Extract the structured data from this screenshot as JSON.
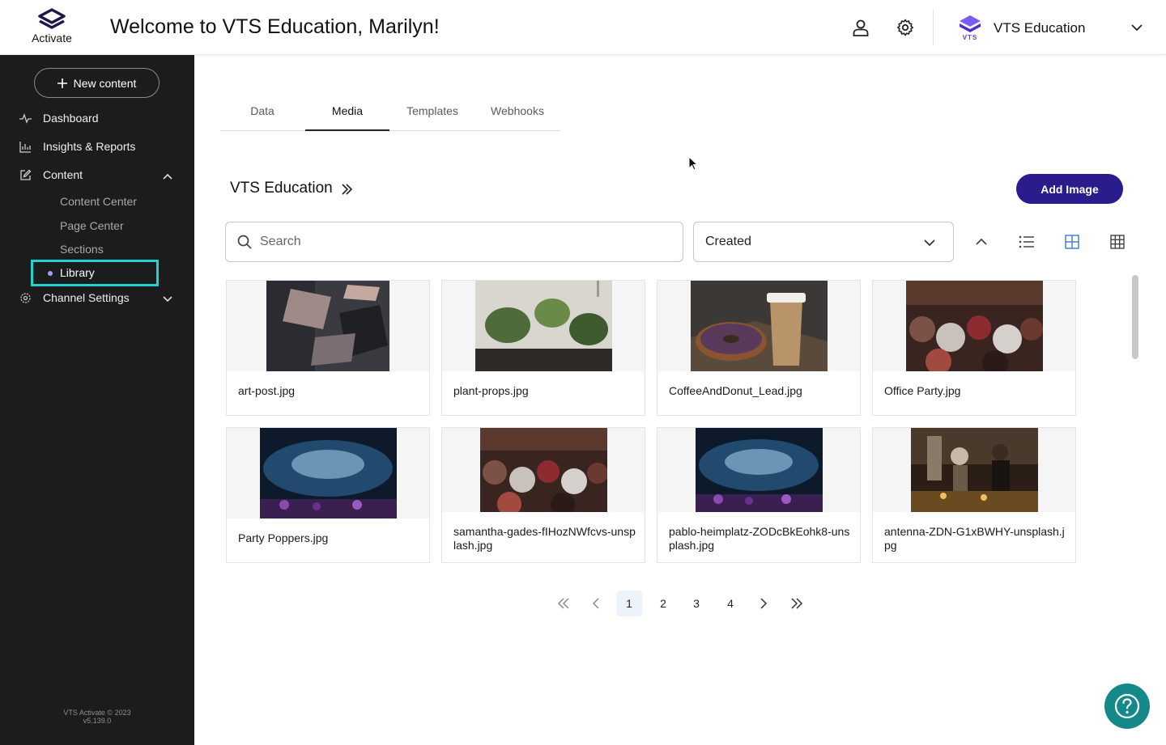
{
  "brand": {
    "name": "Activate"
  },
  "header": {
    "welcome": "Welcome to VTS Education, Marilyn!",
    "org_name": "VTS Education",
    "org_logo_text": "VTS"
  },
  "sidebar": {
    "new_content_label": "New content",
    "items": [
      {
        "label": "Dashboard",
        "icon": "pulse-icon"
      },
      {
        "label": "Insights & Reports",
        "icon": "bar-chart-icon"
      },
      {
        "label": "Content",
        "icon": "edit-icon",
        "expanded": true
      },
      {
        "label": "Channel Settings",
        "icon": "gear-icon",
        "expanded": false
      }
    ],
    "content_subitems": [
      "Content Center",
      "Page Center",
      "Sections",
      "Library"
    ],
    "active_subitem": "Library",
    "footer_line1": "VTS Activate © 2023",
    "footer_line2": "v5.139.0"
  },
  "tabs": [
    {
      "label": "Data"
    },
    {
      "label": "Media"
    },
    {
      "label": "Templates"
    },
    {
      "label": "Webhooks"
    }
  ],
  "active_tab": "Media",
  "library": {
    "folder_title": "VTS Education",
    "add_image_label": "Add Image",
    "search_placeholder": "Search",
    "sort_value": "Created"
  },
  "files": [
    {
      "name": "art-post.jpg"
    },
    {
      "name": "plant-props.jpg"
    },
    {
      "name": "CoffeeAndDonut_Lead.jpg"
    },
    {
      "name": "Office Party.jpg"
    },
    {
      "name": "Party Poppers.jpg"
    },
    {
      "name": "samantha-gades-fIHozNWfcvs-unsplash.jpg"
    },
    {
      "name": "pablo-heimplatz-ZODcBkEohk8-unsplash.jpg"
    },
    {
      "name": "antenna-ZDN-G1xBWHY-unsplash.jpg"
    }
  ],
  "pagination": {
    "pages": [
      "1",
      "2",
      "3",
      "4"
    ],
    "current": "1"
  },
  "colors": {
    "sidebar_bg": "#1c1c1c",
    "accent": "#2a1c8c",
    "highlight": "#1fd3d3",
    "help": "#15888a"
  }
}
